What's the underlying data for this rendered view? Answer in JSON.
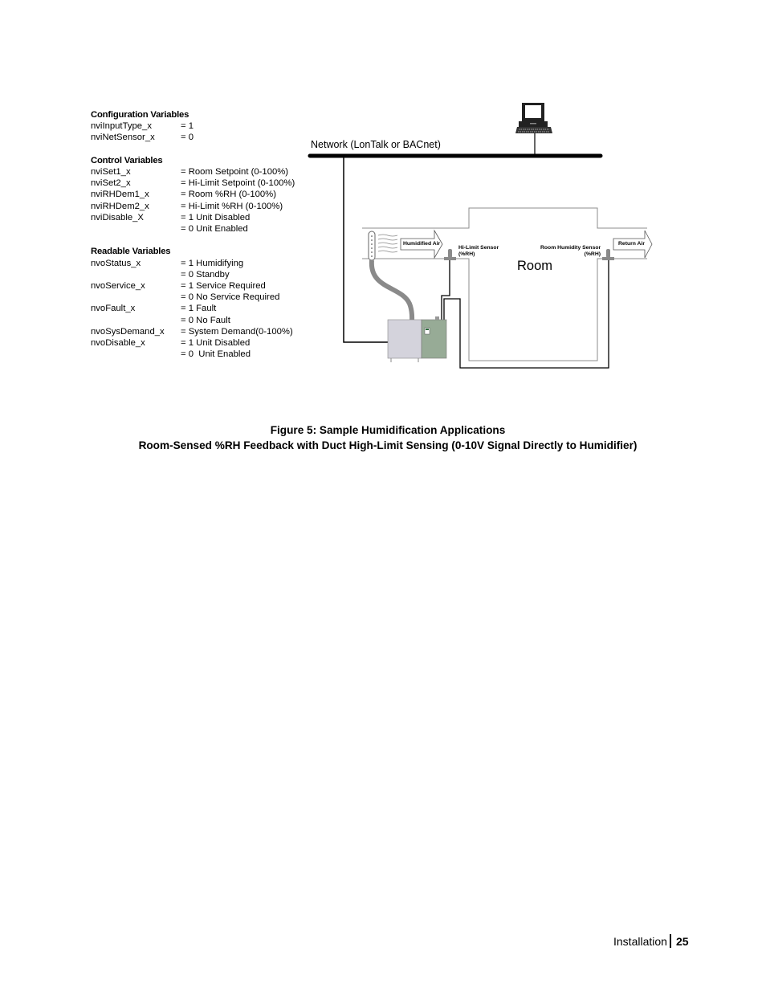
{
  "variables": {
    "configuration": {
      "title": "Configuration Variables",
      "rows": [
        {
          "name": "nviInputType_x",
          "value": "= 1"
        },
        {
          "name": "nviNetSensor_x",
          "value": "= 0"
        }
      ]
    },
    "control": {
      "title": "Control Variables",
      "rows": [
        {
          "name": "nviSet1_x",
          "value": "= Room Setpoint (0-100%)"
        },
        {
          "name": "nviSet2_x",
          "value": "= Hi-Limit Setpoint (0-100%)"
        },
        {
          "name": "nviRHDem1_x",
          "value": "= Room %RH (0-100%)"
        },
        {
          "name": "nviRHDem2_x",
          "value": "= Hi-Limit %RH (0-100%)"
        },
        {
          "name": "nviDisable_X",
          "value": "= 1 Unit Disabled"
        },
        {
          "name": "",
          "value": "= 0 Unit Enabled"
        }
      ]
    },
    "readable": {
      "title": "Readable Variables",
      "rows": [
        {
          "name": "nvoStatus_x",
          "value": "= 1 Humidifying"
        },
        {
          "name": "",
          "value": "= 0 Standby"
        },
        {
          "name": "nvoService_x",
          "value": "= 1 Service Required"
        },
        {
          "name": "",
          "value": "= 0 No Service Required"
        },
        {
          "name": "nvoFault_x",
          "value": "= 1 Fault"
        },
        {
          "name": "",
          "value": "= 0 No Fault"
        },
        {
          "name": "nvoSysDemand_x",
          "value": "= System Demand(0-100%)"
        },
        {
          "name": "nvoDisable_x",
          "value": "= 1 Unit Disabled"
        },
        {
          "name": "",
          "value": "= 0  Unit Enabled"
        }
      ]
    }
  },
  "diagram": {
    "network_label": "Network (LonTalk or BACnet)",
    "room_label": "Room",
    "humidified_air_label": "Humidified Air",
    "return_air_label": "Return Air",
    "hi_limit_sensor_label": "Hi-Limit Sensor",
    "hi_limit_sensor_unit": "(%RH)",
    "room_sensor_label": "Room Humidity Sensor",
    "room_sensor_unit": "(%RH)",
    "colors": {
      "humidifier_left": "#d4d3dc",
      "humidifier_right": "#97ab96",
      "hose": "#8a8a8a",
      "sensor": "#8a8a8a",
      "duct_line": "#8c8c8c"
    }
  },
  "caption": {
    "line1": "Figure 5:  Sample Humidification Applications",
    "line2": "Room-Sensed %RH Feedback with Duct High-Limit Sensing (0-10V Signal Directly to Humidifier)"
  },
  "footer": {
    "section": "Installation",
    "page": "25"
  }
}
